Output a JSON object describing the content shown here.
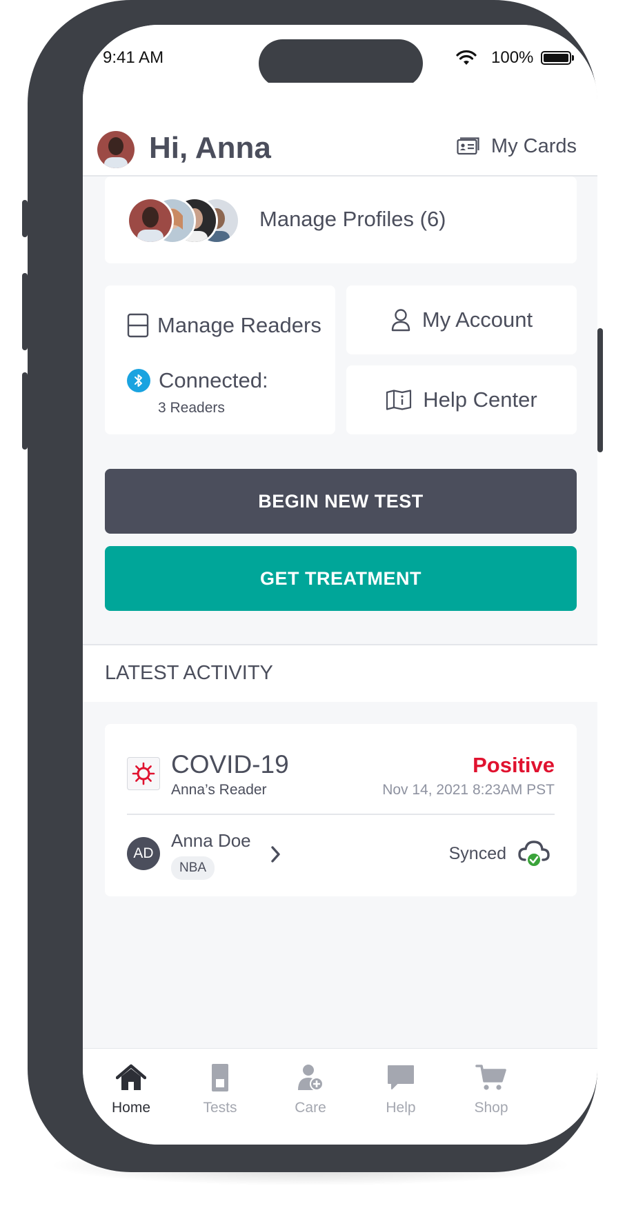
{
  "status_bar": {
    "time": "9:41 AM",
    "battery_percent": "100%"
  },
  "header": {
    "greeting": "Hi, Anna",
    "my_cards_label": "My Cards"
  },
  "profiles": {
    "label": "Manage Profiles (6)"
  },
  "readers": {
    "title": "Manage Readers",
    "connected_label": "Connected:",
    "count_label": "3 Readers"
  },
  "account": {
    "label": "My Account"
  },
  "help_center": {
    "label": "Help Center"
  },
  "buttons": {
    "begin_test": "BEGIN NEW TEST",
    "get_treatment": "GET TREATMENT"
  },
  "colors": {
    "primary_dark": "#4b4e5c",
    "teal": "#00a699",
    "positive_red": "#e0122f",
    "bluetooth_blue": "#1aa3e0",
    "synced_green": "#3aa33a"
  },
  "activity": {
    "section_title": "LATEST ACTIVITY",
    "test_name": "COVID-19",
    "reader_name": "Anna’s Reader",
    "result": "Positive",
    "datetime": "Nov 14, 2021 8:23AM PST",
    "person_initials": "AD",
    "person_name": "Anna Doe",
    "person_tag": "NBA",
    "sync_status": "Synced"
  },
  "tabs": [
    {
      "label": "Home",
      "icon": "home-icon",
      "active": true
    },
    {
      "label": "Tests",
      "icon": "test-icon",
      "active": false
    },
    {
      "label": "Care",
      "icon": "care-icon",
      "active": false
    },
    {
      "label": "Help",
      "icon": "chat-icon",
      "active": false
    },
    {
      "label": "Shop",
      "icon": "cart-icon",
      "active": false
    }
  ]
}
